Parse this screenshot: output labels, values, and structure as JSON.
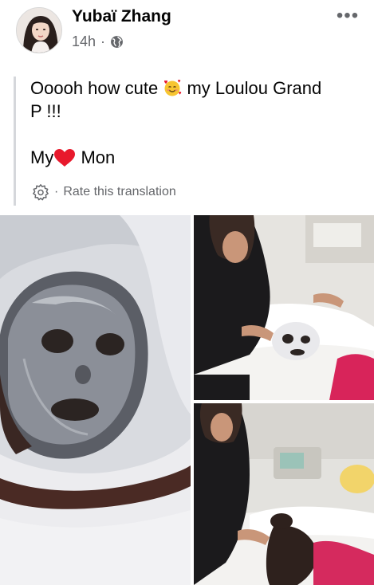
{
  "post": {
    "author_name": "Yubaï Zhang",
    "timestamp": "14h",
    "separator": "·",
    "privacy_icon": "globe-icon",
    "more_icon": "more-horizontal-icon",
    "more_label": "•••"
  },
  "content": {
    "line1_before": "Ooooh how cute",
    "line1_emoji": "smiling-face-with-hearts-icon",
    "line1_after": "my Loulou Grand",
    "line2": "P !!!",
    "line3_before": "My",
    "line3_emoji": "red-heart-icon",
    "line3_after": "Mon"
  },
  "translation": {
    "icon": "gear-icon",
    "separator": "·",
    "rate_label": "Rate this translation"
  },
  "photos": [
    {
      "name": "photo-face-mask"
    },
    {
      "name": "photo-mask-application"
    },
    {
      "name": "photo-body-treatment"
    }
  ]
}
